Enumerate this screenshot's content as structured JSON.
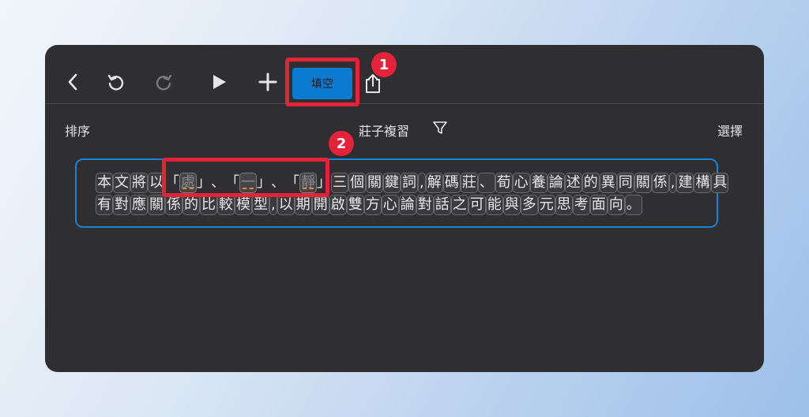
{
  "toolbar": {
    "fill_blank_label": "填空",
    "icons": [
      "chevron-left-icon",
      "undo-icon",
      "redo-icon",
      "play-icon",
      "plus-icon",
      "share-icon"
    ]
  },
  "annotations": {
    "badge1": "1",
    "badge2": "2"
  },
  "subheader": {
    "sort_label": "排序",
    "title": "莊子複習",
    "select_label": "選擇"
  },
  "text": {
    "line1_a": [
      "本",
      "文",
      "將",
      "以"
    ],
    "blank1": "處",
    "blank2": "一",
    "blank3": "靜",
    "quote_open": "「",
    "quote_close": "」",
    "sep": "、",
    "line1_b": [
      "三",
      "個",
      "關",
      "鍵",
      "詞",
      ",",
      "解",
      "碼",
      "莊",
      "、",
      "荀",
      "心",
      "養",
      "論",
      "述",
      "的",
      "異",
      "同",
      "關",
      "係",
      ",",
      "建",
      "構",
      "具"
    ],
    "line2": [
      "有",
      "對",
      "應",
      "關",
      "係",
      "的",
      "比",
      "較",
      "模",
      "型",
      ",",
      "以",
      "期",
      "開",
      "啟",
      "雙",
      "方",
      "心",
      "論",
      "對",
      "話",
      "之",
      "可",
      "能",
      "與",
      "多",
      "元",
      "思",
      "考",
      "面",
      "向",
      "。"
    ]
  },
  "colors": {
    "accent": "#0a7bd1",
    "highlight": "#e4233b",
    "background": "#2f2f31"
  }
}
